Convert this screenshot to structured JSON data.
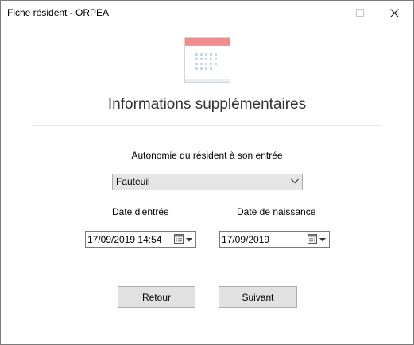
{
  "window": {
    "title": "Fiche résident - ORPEA"
  },
  "header": {
    "title": "Informations supplémentaires"
  },
  "form": {
    "autonomie_label": "Autonomie du résident à son entrée",
    "autonomie_value": "Fauteuil",
    "date_entree_label": "Date d'entrée",
    "date_entree_value": "17/09/2019 14:54",
    "date_naissance_label": "Date de naissance",
    "date_naissance_value": "17/09/2019"
  },
  "buttons": {
    "retour": "Retour",
    "suivant": "Suivant"
  },
  "icons": {
    "minimize": "minimize-icon",
    "maximize": "maximize-icon",
    "close": "close-icon",
    "header_illustration": "calendar-icon",
    "dropdown": "chevron-down-icon",
    "date_picker": "calendar-dropdown-icon"
  },
  "colors": {
    "calendar_header": "#f28b8b",
    "calendar_dots": "#c8d7e6",
    "button_bg": "#e1e1e1"
  }
}
